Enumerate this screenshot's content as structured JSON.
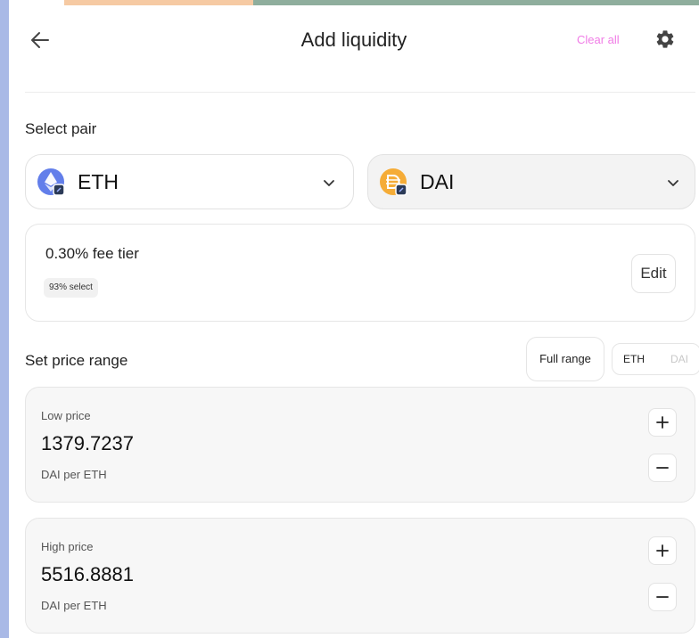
{
  "header": {
    "title": "Add liquidity",
    "clear_all_label": "Clear all",
    "back_icon": "arrow-left-icon",
    "settings_icon": "gear-icon"
  },
  "pair": {
    "section_label": "Select pair",
    "token_a": {
      "symbol": "ETH",
      "icon": "eth-token-icon"
    },
    "token_b": {
      "symbol": "DAI",
      "icon": "dai-token-icon"
    }
  },
  "fee": {
    "tier_label": "0.30% fee tier",
    "select_badge": "93% select",
    "edit_label": "Edit"
  },
  "range": {
    "section_label": "Set price range",
    "full_range_label": "Full range",
    "toggle": {
      "active": "ETH",
      "inactive": "DAI"
    }
  },
  "low_price": {
    "label": "Low price",
    "value": "1379.7237",
    "unit": "DAI per ETH"
  },
  "high_price": {
    "label": "High price",
    "value": "5516.8881",
    "unit": "DAI per ETH"
  },
  "colors": {
    "accent": "#f07ce6",
    "eth_blue": "#627eea",
    "dai_yellow": "#f5ac37"
  }
}
